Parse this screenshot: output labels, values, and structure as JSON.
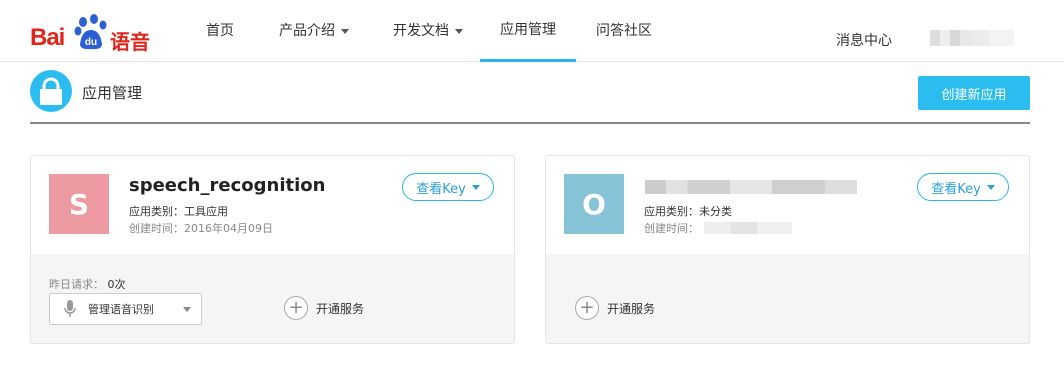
{
  "brand": {
    "logo_bai": "Bai",
    "logo_du": "du",
    "logo_suffix": "语音"
  },
  "nav": {
    "items": [
      {
        "label": "首页",
        "dropdown": false,
        "active": false
      },
      {
        "label": "产品介绍",
        "dropdown": true,
        "active": false
      },
      {
        "label": "开发文档",
        "dropdown": true,
        "active": false
      },
      {
        "label": "应用管理",
        "dropdown": false,
        "active": true
      },
      {
        "label": "问答社区",
        "dropdown": false,
        "active": false
      }
    ],
    "message_center": "消息中心"
  },
  "page": {
    "title": "应用管理",
    "create_button": "创建新应用"
  },
  "apps": [
    {
      "initial": "S",
      "avatar_color": "#ee9aa3",
      "name": "speech_recognition",
      "category": "应用类别：工具应用",
      "created": "创建时间：2016年04月09日",
      "view_key": "查看Key",
      "yesterday_requests_label": "昨日请求：",
      "yesterday_requests_value": "0次",
      "service_select": "管理语音识别",
      "open_service": "开通服务"
    },
    {
      "initial": "O",
      "avatar_color": "#86c3d6",
      "name": "",
      "category": "应用类别：未分类",
      "created": "创建时间：",
      "view_key": "查看Key",
      "open_service": "开通服务"
    }
  ],
  "colors": {
    "accent": "#2bbdf0",
    "brand_red": "#e1251b"
  }
}
